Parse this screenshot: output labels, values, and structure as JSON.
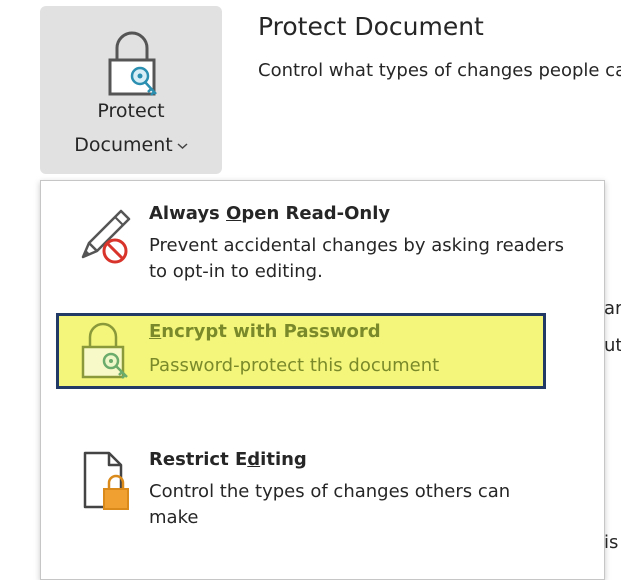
{
  "ribbon": {
    "button_line1": "Protect",
    "button_line2": "Document",
    "button_icon": "lock-key-icon",
    "chevron_icon": "chevron-down-icon"
  },
  "section": {
    "title": "Protect Document",
    "description": "Control what types of changes people can make to this document."
  },
  "background_fragments": [
    "ar",
    "ut",
    "is"
  ],
  "menu": {
    "items": [
      {
        "title_prefix": "Always ",
        "title_accel": "O",
        "title_suffix": "pen Read-Only",
        "description": "Prevent accidental changes by asking readers to opt-in to editing.",
        "icon": "pencil-no-edit-icon"
      },
      {
        "title_prefix": "",
        "title_accel": "E",
        "title_suffix": "ncrypt with Password",
        "description": "Password-protect this document",
        "icon": "lock-key-icon",
        "highlighted": true
      },
      {
        "title_prefix": "Restrict E",
        "title_accel": "d",
        "title_suffix": "iting",
        "description": "Control the types of changes others can make",
        "icon": "document-lock-icon"
      }
    ]
  },
  "colors": {
    "highlight_fill": "#f4f67c",
    "highlight_border": "#213a66",
    "lock_key_teal": "#2a8fb0",
    "prohibit_red": "#d9342b",
    "lock_orange": "#f0a030"
  }
}
